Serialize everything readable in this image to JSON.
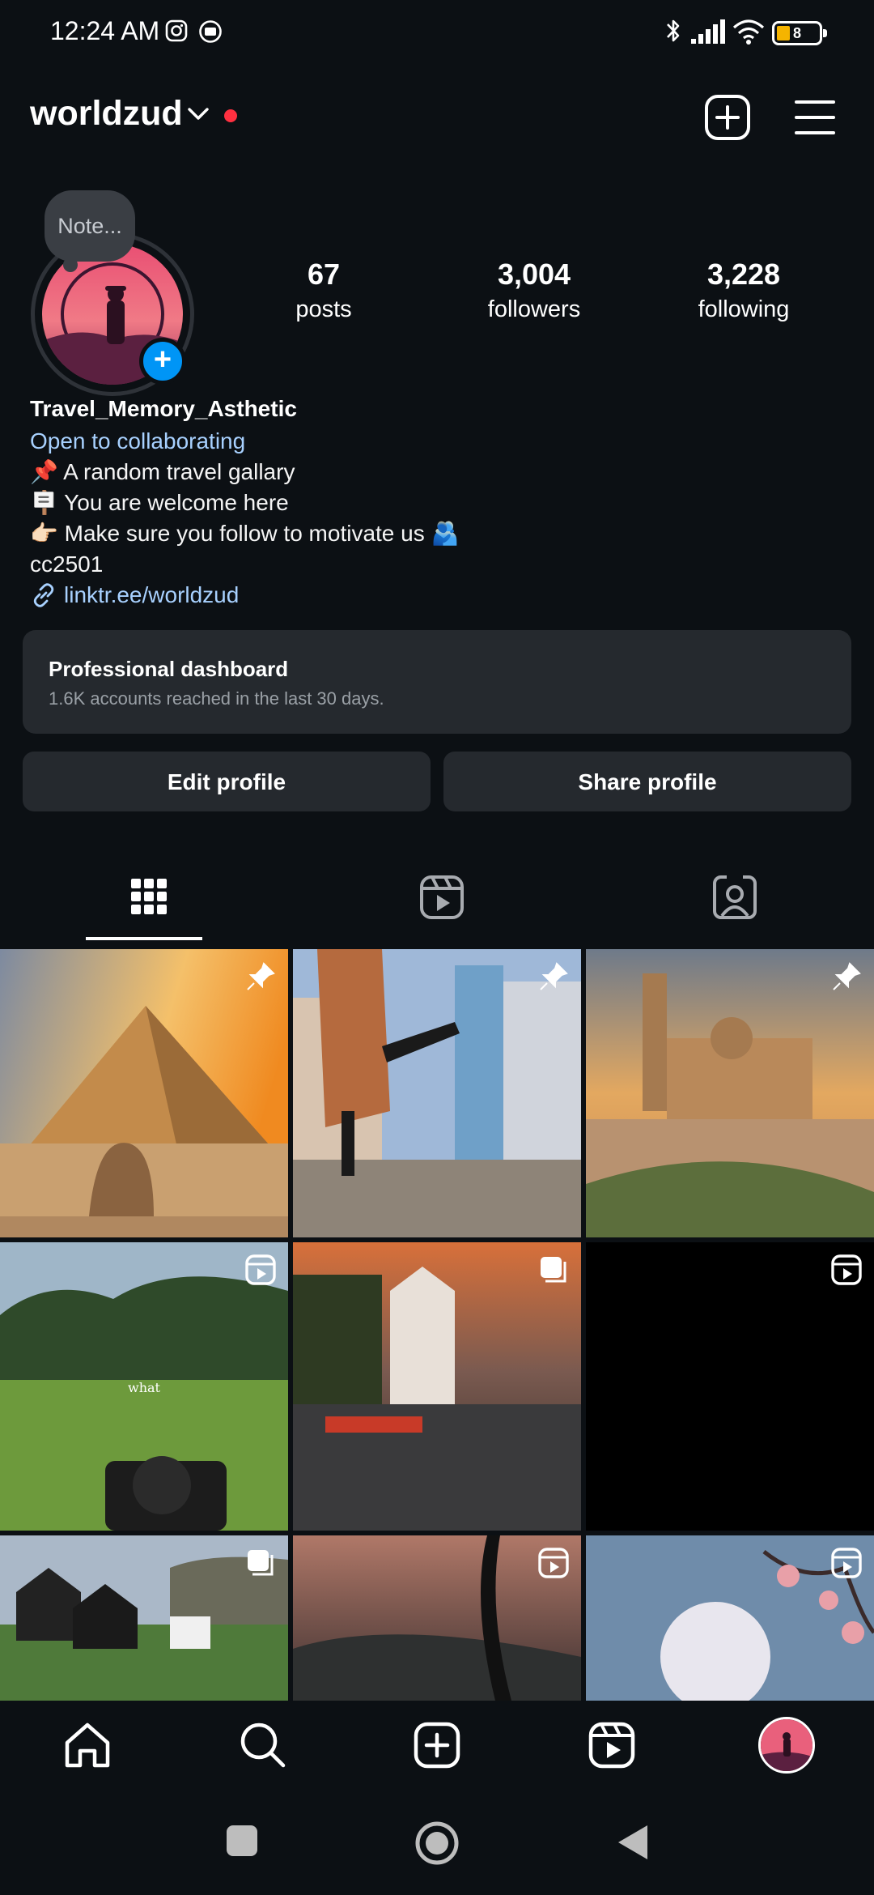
{
  "status_bar": {
    "time": "12:24 AM",
    "battery": "8",
    "icons": [
      "instagram-icon",
      "media-icon",
      "bluetooth-icon",
      "signal-icon",
      "wifi-icon",
      "battery-icon"
    ]
  },
  "header": {
    "username": "worldzud",
    "icons": [
      "chevron-down-icon",
      "new-post-icon",
      "menu-icon"
    ]
  },
  "profile": {
    "note": "Note...",
    "stats": [
      {
        "value": "67",
        "label": "posts"
      },
      {
        "value": "3,004",
        "label": "followers"
      },
      {
        "value": "3,228",
        "label": "following"
      }
    ],
    "bio": {
      "name": "Travel_Memory_Asthetic",
      "collab": "Open to collaborating",
      "lines": [
        "📌 A random travel gallary",
        "🪧 You are welcome here",
        "👉🏻 Make sure you follow to motivate us 🫂"
      ],
      "tag": "cc2501",
      "link": "linktr.ee/worldzud"
    }
  },
  "dashboard": {
    "title": "Professional dashboard",
    "subtitle": "1.6K accounts reached in the last 30 days."
  },
  "actions": {
    "edit": "Edit profile",
    "share": "Share profile"
  },
  "tabs": [
    "grid-icon",
    "reels-icon",
    "tagged-icon"
  ],
  "grid": {
    "overlay_text": "what",
    "badges": [
      "pin-icon",
      "pin-icon",
      "pin-icon",
      "reel-icon",
      "carousel-icon",
      "reel-icon",
      "carousel-icon",
      "reel-icon",
      "reel-icon"
    ]
  },
  "bottom_nav": [
    "home-icon",
    "search-icon",
    "create-icon",
    "reels-icon",
    "profile-avatar"
  ],
  "colors": {
    "background": "#0c1014",
    "card": "#25292e",
    "link": "#a8d1ff",
    "accent": "#0095f6",
    "live_dot": "#ff3040"
  }
}
